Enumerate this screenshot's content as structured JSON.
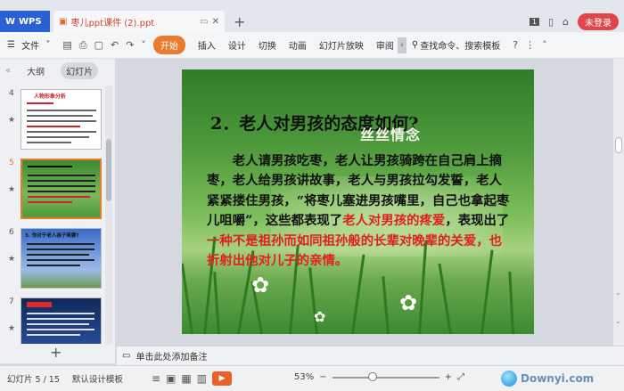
{
  "titlebar": {
    "app_name": "WPS",
    "doc_tab": "枣儿ppt课件 (2).ppt",
    "login_label": "未登录"
  },
  "ribbon": {
    "file_label": "文件",
    "start_label": "开始",
    "items": [
      "插入",
      "设计",
      "切换",
      "动画",
      "幻灯片放映",
      "审阅"
    ],
    "search_label": "查找命令、搜索模板"
  },
  "leftpanel": {
    "tab_outline": "大纲",
    "tab_slides": "幻灯片",
    "thumb_numbers": [
      "4",
      "5",
      "6",
      "7"
    ],
    "thumb4_title": "人物形象分析",
    "thumb6_title": "3. 你对于老人孩子简要?"
  },
  "slide": {
    "title": "2．老人对男孩的态度如何?",
    "deco_text": "丝丝情念",
    "body_black": "老人请男孩吃枣，老人让男孩骑跨在自己肩上摘枣，老人给男孩讲故事，老人与男孩拉勾发誓，老人紧紧搂住男孩，“将枣儿塞进男孩嘴里，自己也拿起枣儿咀嚼”，这些都表现了",
    "body_red1": "老人对男孩的疼爱",
    "body_black2": "，表现出了",
    "body_red2": "一种不是祖孙而如同祖孙般的长辈对晚辈的关爱，也折射出他对儿子的亲情。"
  },
  "notes": {
    "placeholder": "单击此处添加备注"
  },
  "statusbar": {
    "slide_counter": "幻灯片 5 / 15",
    "template": "默认设计模板",
    "zoom": "53%",
    "watermark": "Downyi.com"
  },
  "colors": {
    "accent_orange": "#e87b2e",
    "wps_blue": "#2b5fd4",
    "login_red": "#e0454a",
    "slide_red_text": "#e01f1f"
  }
}
